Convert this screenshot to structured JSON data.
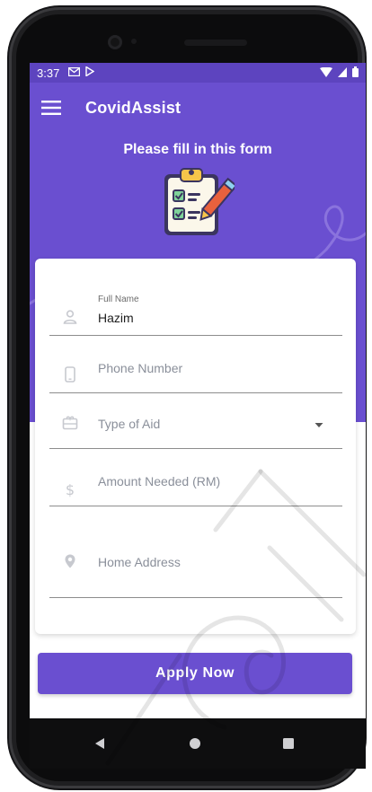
{
  "status": {
    "time": "3:37"
  },
  "app": {
    "title": "CovidAssist"
  },
  "hero": {
    "heading": "Please fill in this form"
  },
  "form": {
    "full_name": {
      "label": "Full Name",
      "value": "Hazim"
    },
    "phone": {
      "placeholder": "Phone Number"
    },
    "aid_type": {
      "placeholder": "Type of Aid"
    },
    "amount": {
      "placeholder": "Amount Needed (RM)"
    },
    "address": {
      "placeholder": "Home Address"
    }
  },
  "actions": {
    "apply_label": "Apply Now"
  },
  "colors": {
    "primary": "#6a4fd0",
    "status_bar": "#5d44bf",
    "icon_muted": "#c7c9cf"
  }
}
